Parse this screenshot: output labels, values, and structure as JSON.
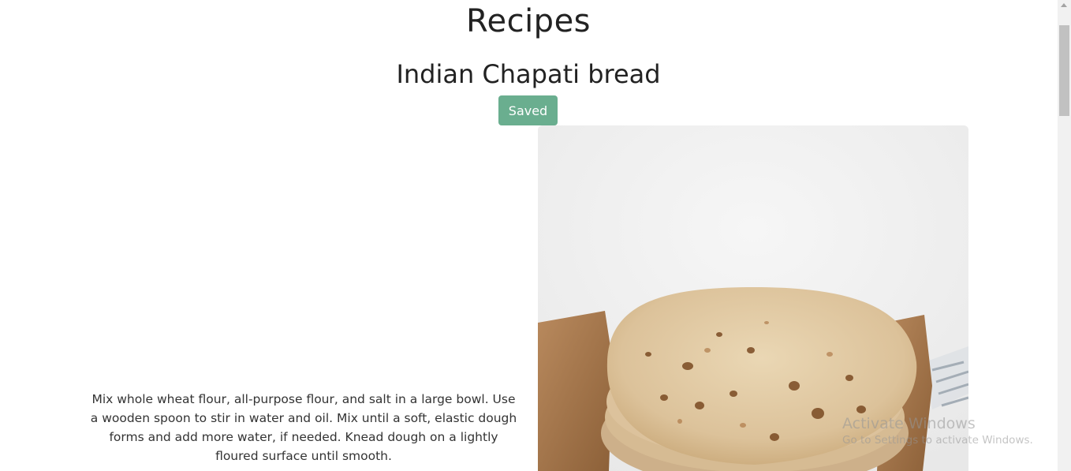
{
  "page": {
    "title": "Recipes"
  },
  "recipe": {
    "title": "Indian Chapati bread",
    "saved_label": "Saved",
    "instructions": "Mix whole wheat flour, all-purpose flour, and salt in a large bowl. Use a wooden spoon to stir in water and oil. Mix until a soft, elastic dough forms and add more water, if needed. Knead dough on a lightly floured surface until smooth.",
    "image_icon": "chapati-photo"
  },
  "watermark": {
    "title": "Activate Windows",
    "subtitle": "Go to Settings to activate Windows."
  },
  "colors": {
    "saved_button": "#6aae8f",
    "text": "#222222"
  }
}
